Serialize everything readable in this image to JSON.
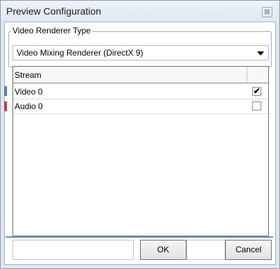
{
  "window": {
    "title": "Preview Configuration",
    "close_glyph": "⊠"
  },
  "renderer": {
    "group_label": "Video Renderer Type",
    "selected": "Video Mixing Renderer (DirectX 9)"
  },
  "streams": {
    "header": "Stream",
    "rows": [
      {
        "label": "Video 0",
        "checked": true
      },
      {
        "label": "Audio 0",
        "checked": false
      }
    ]
  },
  "buttons": {
    "ok": "OK",
    "cancel": "Cancel"
  },
  "colors": {
    "accent_blue": "#4a7fc0",
    "accent_red": "#d9333f"
  }
}
